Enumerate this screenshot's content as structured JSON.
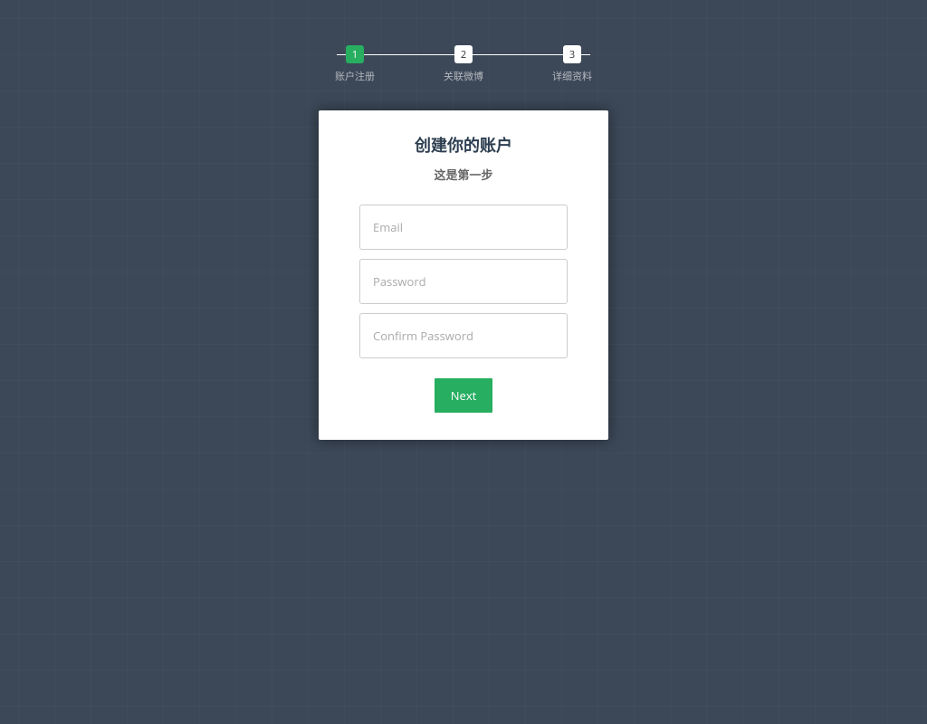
{
  "steps": [
    {
      "num": "1",
      "label": "账户注册",
      "active": true
    },
    {
      "num": "2",
      "label": "关联微博",
      "active": false
    },
    {
      "num": "3",
      "label": "详细资料",
      "active": false
    }
  ],
  "form": {
    "title": "创建你的账户",
    "subtitle": "这是第一步",
    "email_placeholder": "Email",
    "password_placeholder": "Password",
    "confirm_placeholder": "Confirm Password",
    "next_label": "Next"
  }
}
